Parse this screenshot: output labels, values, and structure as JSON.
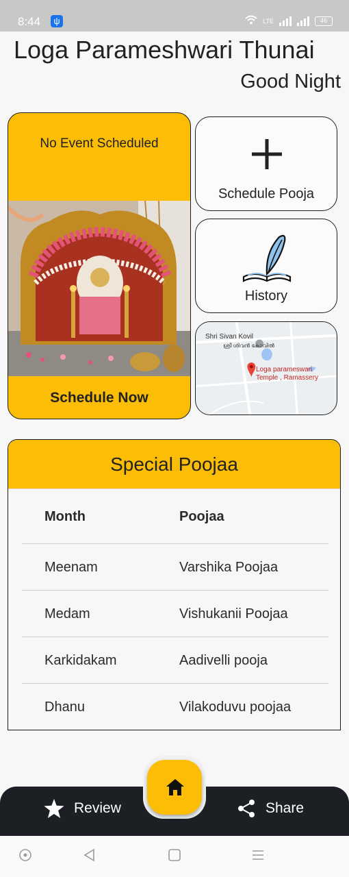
{
  "status_bar": {
    "time": "8:44",
    "battery": "46",
    "network": "LTE"
  },
  "header": {
    "app_title": "Loga Parameshwari Thunai",
    "greeting": "Good Night"
  },
  "event_card": {
    "status_text": "No Event Scheduled",
    "action_label": "Schedule Now",
    "image_subject": "temple-deity-shrine"
  },
  "tiles": {
    "schedule_label": "Schedule Pooja",
    "history_label": "History",
    "map": {
      "place1": "Shri Sivan Kovil",
      "place1_local": "ശ്രീ ശിവൻ കോവിൽ",
      "place2_line1": "Loga parameswari",
      "place2_line2": "Temple , Ramassery"
    }
  },
  "special": {
    "title": "Special Poojaa",
    "columns": [
      "Month",
      "Poojaa"
    ],
    "rows": [
      [
        "Meenam",
        "Varshika Poojaa"
      ],
      [
        "Medam",
        "Vishukanii Poojaa"
      ],
      [
        "Karkidakam",
        "Aadivelli pooja"
      ],
      [
        "Dhanu",
        "Vilakoduvu poojaa"
      ]
    ]
  },
  "bottom_bar": {
    "review_label": "Review",
    "share_label": "Share"
  },
  "colors": {
    "accent": "#fbbd06",
    "dark_bar": "#1c1f24",
    "background": "#f7f7f7"
  },
  "icons": {
    "plus": "plus-icon",
    "history": "quill-book-icon",
    "home": "home-icon",
    "review": "star-icon",
    "share": "share-icon"
  }
}
